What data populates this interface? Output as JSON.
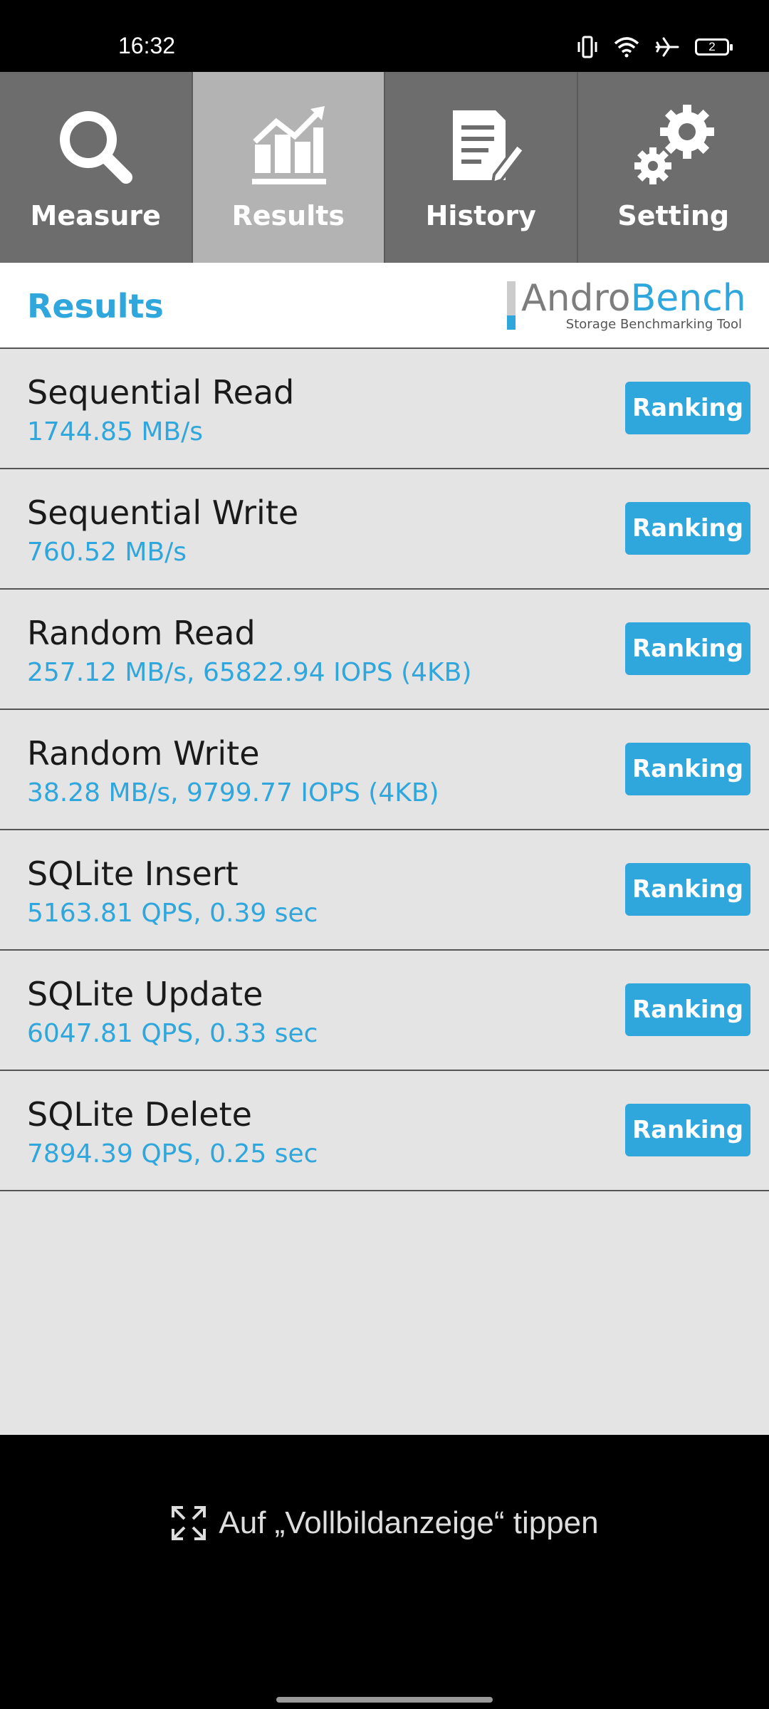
{
  "status_bar": {
    "time": "16:32",
    "battery": "2"
  },
  "tabs": [
    {
      "label": "Measure",
      "icon": "search-icon",
      "active": false
    },
    {
      "label": "Results",
      "icon": "chart-icon",
      "active": true
    },
    {
      "label": "History",
      "icon": "document-icon",
      "active": false
    },
    {
      "label": "Setting",
      "icon": "gears-icon",
      "active": false
    }
  ],
  "header": {
    "title": "Results",
    "logo_part1": "Andro",
    "logo_part2": "Bench",
    "logo_subtitle": "Storage Benchmarking Tool"
  },
  "results": [
    {
      "title": "Sequential Read",
      "value": "1744.85 MB/s",
      "button": "Ranking"
    },
    {
      "title": "Sequential Write",
      "value": "760.52 MB/s",
      "button": "Ranking"
    },
    {
      "title": "Random Read",
      "value": "257.12 MB/s, 65822.94 IOPS (4KB)",
      "button": "Ranking"
    },
    {
      "title": "Random Write",
      "value": "38.28 MB/s, 9799.77 IOPS (4KB)",
      "button": "Ranking"
    },
    {
      "title": "SQLite Insert",
      "value": "5163.81 QPS, 0.39 sec",
      "button": "Ranking"
    },
    {
      "title": "SQLite Update",
      "value": "6047.81 QPS, 0.33 sec",
      "button": "Ranking"
    },
    {
      "title": "SQLite Delete",
      "value": "7894.39 QPS, 0.25 sec",
      "button": "Ranking"
    }
  ],
  "footer": {
    "fullscreen_hint": "Auf „Vollbildanzeige“ tippen"
  },
  "colors": {
    "accent": "#2fa6dc",
    "tab_bg": "#6d6d6d",
    "tab_active": "#b3b3b3",
    "list_bg": "#e4e4e4"
  }
}
